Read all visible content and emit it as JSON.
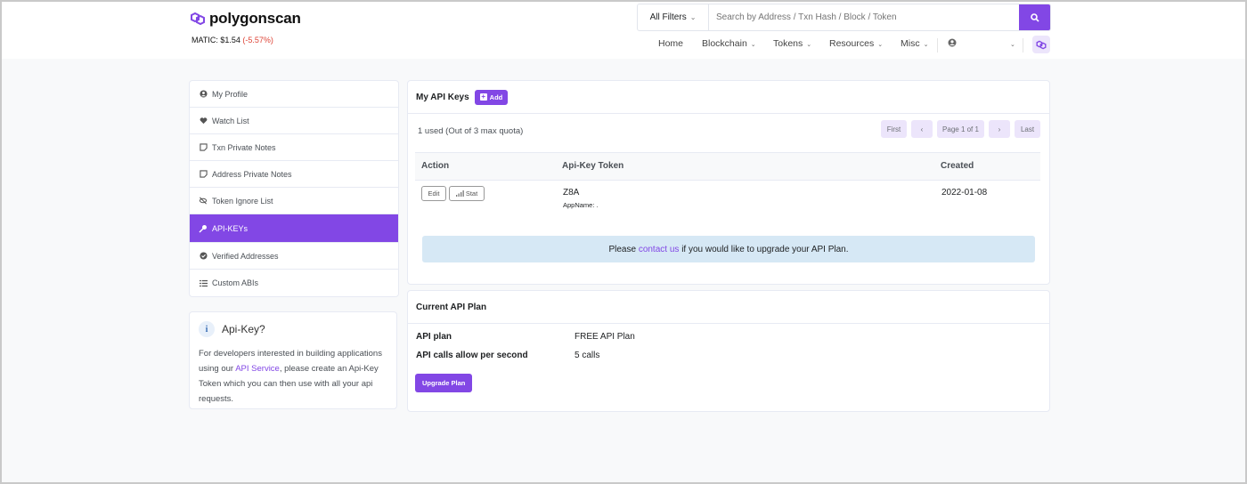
{
  "brand": {
    "name": "polygonscan",
    "accent": "#8247e5"
  },
  "price": {
    "label": "MATIC: $1.54",
    "change": "(-5.57%)"
  },
  "search": {
    "filter_label": "All Filters",
    "placeholder": "Search by Address / Txn Hash / Block / Token"
  },
  "nav": [
    "Home",
    "Blockchain",
    "Tokens",
    "Resources",
    "Misc"
  ],
  "sidebar": {
    "items": [
      {
        "label": "My Profile",
        "icon": "user-circle-icon"
      },
      {
        "label": "Watch List",
        "icon": "heart-icon"
      },
      {
        "label": "Txn Private Notes",
        "icon": "sticky-note-icon"
      },
      {
        "label": "Address Private Notes",
        "icon": "sticky-note-icon"
      },
      {
        "label": "Token Ignore List",
        "icon": "eye-slash-icon"
      },
      {
        "label": "API-KEYs",
        "icon": "key-icon",
        "active": true
      },
      {
        "label": "Verified Addresses",
        "icon": "check-circle-icon"
      },
      {
        "label": "Custom ABIs",
        "icon": "list-icon"
      }
    ]
  },
  "info": {
    "title": "Api-Key?",
    "text_before": "For developers interested in building applications using our ",
    "link": "API Service",
    "text_after": ", please create an Api-Key Token which you can then use with all your api requests."
  },
  "api_keys": {
    "title": "My API Keys",
    "add_label": "Add",
    "quota": "1 used (Out of 3 max quota)",
    "pager": {
      "first": "First",
      "prev": "‹",
      "page": "Page 1 of 1",
      "next": "›",
      "last": "Last"
    },
    "columns": [
      "Action",
      "Api-Key Token",
      "Created"
    ],
    "rows": [
      {
        "edit": "Edit",
        "stat": "Stat",
        "token": "Z8A",
        "appname": "AppName: .",
        "created": "2022-01-08"
      }
    ],
    "notice": {
      "before": "Please ",
      "link": "contact us",
      "after": " if you would like to upgrade your API Plan."
    }
  },
  "plan": {
    "title": "Current API Plan",
    "rows": [
      {
        "label": "API plan",
        "value": "FREE API Plan"
      },
      {
        "label": "API calls allow per second",
        "value": "5 calls"
      }
    ],
    "upgrade_label": "Upgrade Plan"
  }
}
